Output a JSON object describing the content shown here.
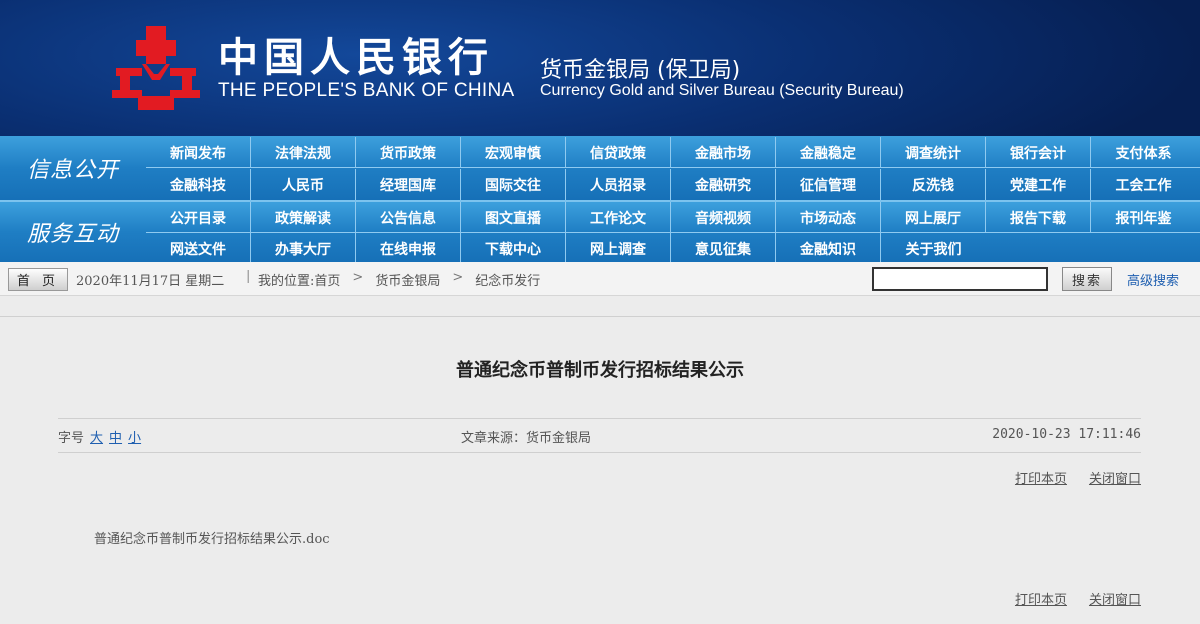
{
  "header": {
    "cn_title": "中国人民银行",
    "en_title": "THE PEOPLE'S BANK OF CHINA",
    "bureau_cn": "货币金银局 (保卫局)",
    "bureau_en": "Currency  Gold and Silver Bureau (Security Bureau)",
    "logo_color": "#e21b22"
  },
  "nav_info": {
    "label": "信息公开",
    "row1": [
      "新闻发布",
      "法律法规",
      "货币政策",
      "宏观审慎",
      "信贷政策",
      "金融市场",
      "金融稳定",
      "调查统计",
      "银行会计",
      "支付体系"
    ],
    "row2": [
      "金融科技",
      "人民币",
      "经理国库",
      "国际交往",
      "人员招录",
      "金融研究",
      "征信管理",
      "反洗钱",
      "党建工作",
      "工会工作"
    ]
  },
  "nav_service": {
    "label": "服务互动",
    "row1": [
      "公开目录",
      "政策解读",
      "公告信息",
      "图文直播",
      "工作论文",
      "音频视频",
      "市场动态",
      "网上展厅",
      "报告下载",
      "报刊年鉴"
    ],
    "row2": [
      "网送文件",
      "办事大厅",
      "在线申报",
      "下载中心",
      "网上调查",
      "意见征集",
      "金融知识",
      "关于我们"
    ]
  },
  "breadcrumb": {
    "home": "首 页",
    "date": "2020年11月17日  星期二",
    "sep": "|",
    "location_label": "我的位置:",
    "crumbs": [
      "首页",
      "货币金银局",
      "纪念币发行"
    ]
  },
  "search": {
    "value": "",
    "button": "搜索",
    "advanced": "高级搜索"
  },
  "article": {
    "title": "普通纪念币普制币发行招标结果公示",
    "fontsize_label": "字号",
    "fontsize_options": [
      "大",
      "中",
      "小"
    ],
    "source": "文章来源：货币金银局",
    "pubtime": "2020-10-23 17:11:46",
    "print": "打印本页",
    "close": "关闭窗口",
    "attachment": "普通纪念币普制币发行招标结果公示.doc"
  }
}
